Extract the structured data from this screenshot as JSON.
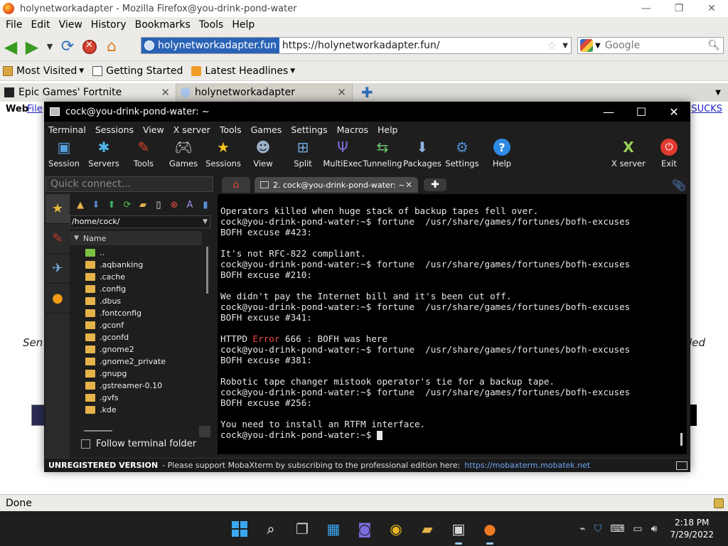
{
  "firefox": {
    "title": "holynetworkadapter - Mozilla Firefox@you-drink-pond-water",
    "window_controls": [
      "—",
      "❐",
      "✕"
    ],
    "menu": [
      "File",
      "Edit",
      "View",
      "History",
      "Bookmarks",
      "Tools",
      "Help"
    ],
    "url_site": "holynetworkadapter.fun",
    "url": "https://holynetworkadapter.fun/",
    "search_placeholder": "Google",
    "bookmarks": [
      "Most Visited",
      "Getting Started",
      "Latest Headlines"
    ],
    "tabs": [
      "Epic Games' Fortnite",
      "holynetworkadapter"
    ],
    "content": {
      "web": "Web",
      "files": "File",
      "sucks": "SUCKS",
      "left_fragment": "Sen",
      "right_fragment": "led"
    },
    "status": "Done"
  },
  "moba": {
    "title": "cock@you-drink-pond-water: ~",
    "window_controls": [
      "—",
      "☐",
      "✕"
    ],
    "menu": [
      "Terminal",
      "Sessions",
      "View",
      "X server",
      "Tools",
      "Games",
      "Settings",
      "Macros",
      "Help"
    ],
    "toolbar": [
      {
        "label": "Session",
        "icon": "session-icon"
      },
      {
        "label": "Servers",
        "icon": "servers-icon"
      },
      {
        "label": "Tools",
        "icon": "tools-icon"
      },
      {
        "label": "Games",
        "icon": "games-icon"
      },
      {
        "label": "Sessions",
        "icon": "sessions-star-icon"
      },
      {
        "label": "View",
        "icon": "view-icon"
      },
      {
        "label": "Split",
        "icon": "split-icon"
      },
      {
        "label": "MultiExec",
        "icon": "multiexec-icon"
      },
      {
        "label": "Tunneling",
        "icon": "tunneling-icon"
      },
      {
        "label": "Packages",
        "icon": "packages-icon"
      },
      {
        "label": "Settings",
        "icon": "settings-icon"
      },
      {
        "label": "Help",
        "icon": "help-icon"
      },
      {
        "label": "X server",
        "icon": "xserver-icon"
      },
      {
        "label": "Exit",
        "icon": "exit-icon"
      }
    ],
    "quick_connect_placeholder": "Quick connect...",
    "session_tab": "2. cock@you-drink-pond-water: ~",
    "sftp": {
      "path": "/home/cock/",
      "column": "Name",
      "files": [
        "..",
        ".aqbanking",
        ".cache",
        ".config",
        ".dbus",
        ".fontconfig",
        ".gconf",
        ".gconfd",
        ".gnome2",
        ".gnome2_private",
        ".gnupg",
        ".gstreamer-0.10",
        ".gvfs",
        ".kde"
      ],
      "follow_label": "Follow terminal folder"
    },
    "terminal": {
      "prompt": "cock@you-drink-pond-water:~$ ",
      "command": "fortune  /usr/share/games/fortunes/bofh-excuses",
      "lines": [
        "Operators killed when huge stack of backup tapes fell over.",
        "cock@you-drink-pond-water:~$ fortune  /usr/share/games/fortunes/bofh-excuses",
        "BOFH excuse #423:",
        "",
        "It's not RFC-822 compliant.",
        "cock@you-drink-pond-water:~$ fortune  /usr/share/games/fortunes/bofh-excuses",
        "BOFH excuse #210:",
        "",
        "We didn't pay the Internet bill and it's been cut off.",
        "cock@you-drink-pond-water:~$ fortune  /usr/share/games/fortunes/bofh-excuses",
        "BOFH excuse #341:",
        "",
        "HTTPD ",
        "cock@you-drink-pond-water:~$ fortune  /usr/share/games/fortunes/bofh-excuses",
        "BOFH excuse #381:",
        "",
        "Robotic tape changer mistook operator's tie for a backup tape.",
        "cock@you-drink-pond-water:~$ fortune  /usr/share/games/fortunes/bofh-excuses",
        "BOFH excuse #256:",
        "",
        "You need to install an RTFM interface.",
        "cock@you-drink-pond-water:~$ "
      ],
      "error_word": "Error",
      "error_rest": " 666 : BOFH was here"
    },
    "status": {
      "unregistered": "UNREGISTERED VERSION",
      "message": "-  Please support MobaXterm by subscribing to the professional edition here:",
      "link": "https://mobaxterm.mobatek.net"
    }
  },
  "taskbar": {
    "time": "2:18 PM",
    "date": "7/29/2022"
  }
}
